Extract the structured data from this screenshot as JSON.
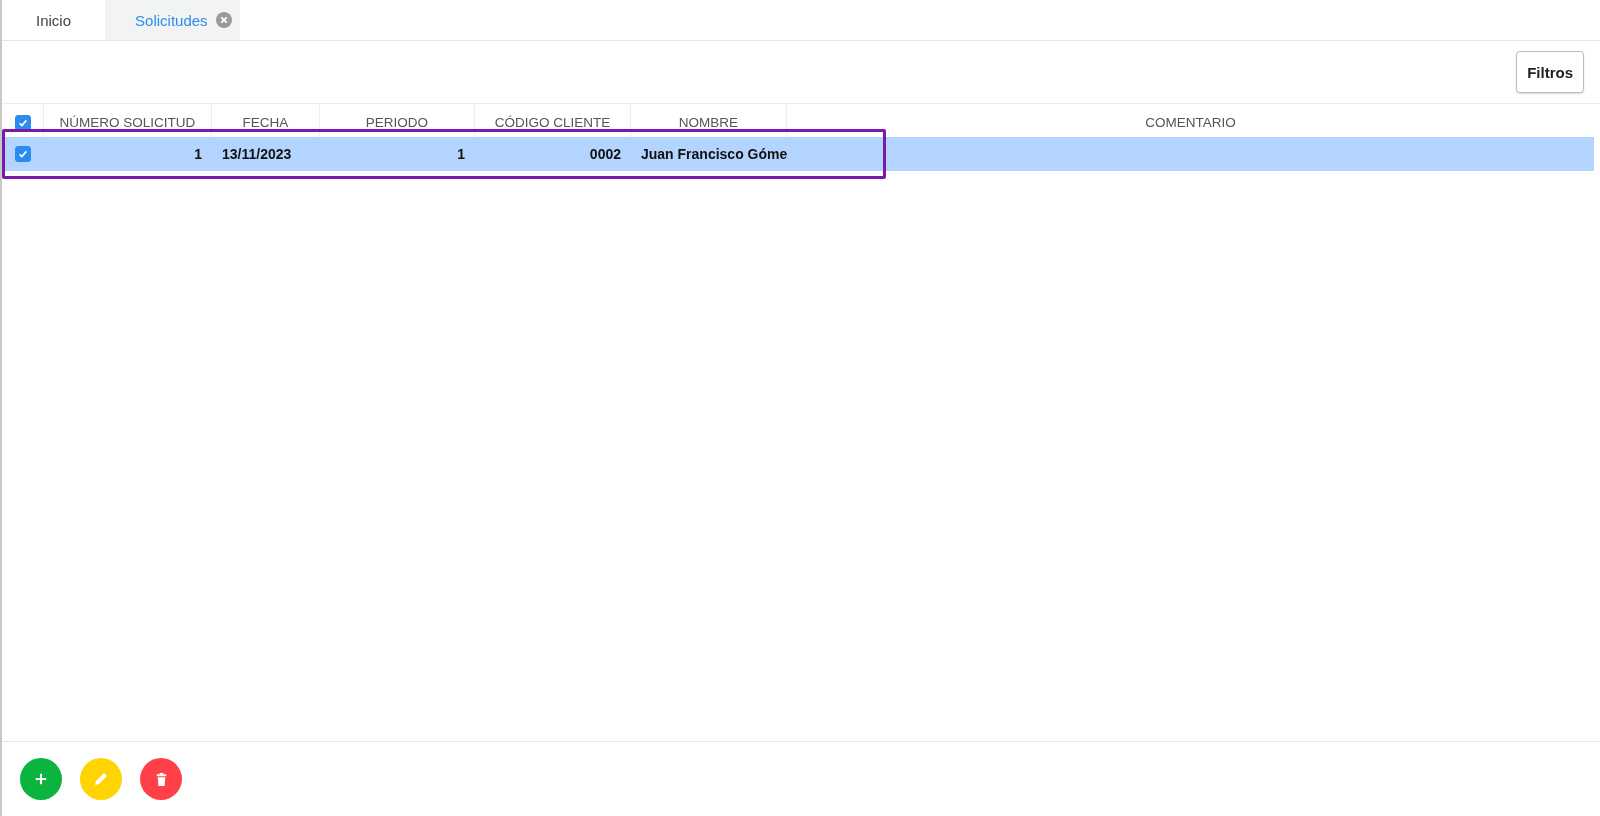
{
  "tabs": [
    {
      "label": "Inicio",
      "selected": false
    },
    {
      "label": "Solicitudes",
      "selected": true
    }
  ],
  "toolbar": {
    "filter_button": "Filtros"
  },
  "table": {
    "select_all_checked": true,
    "columns": [
      {
        "label": "NÚMERO SOLICITUD",
        "numeric": true
      },
      {
        "label": "FECHA",
        "numeric": false
      },
      {
        "label": "PERIODO",
        "numeric": true
      },
      {
        "label": "CÓDIGO CLIENTE",
        "numeric": true
      },
      {
        "label": "NOMBRE",
        "numeric": false
      },
      {
        "label": "COMENTARIO"
      }
    ],
    "rows": [
      {
        "selected": true,
        "checked": true,
        "cells": [
          "1",
          "13/11/2023",
          "1",
          "0002",
          "Juan Francisco Góme",
          ""
        ]
      }
    ]
  },
  "actions": [
    {
      "kind": "add",
      "color": "#0bb33f"
    },
    {
      "kind": "edit",
      "color": "#ffd400"
    },
    {
      "kind": "delete",
      "color": "#ff4049"
    }
  ]
}
